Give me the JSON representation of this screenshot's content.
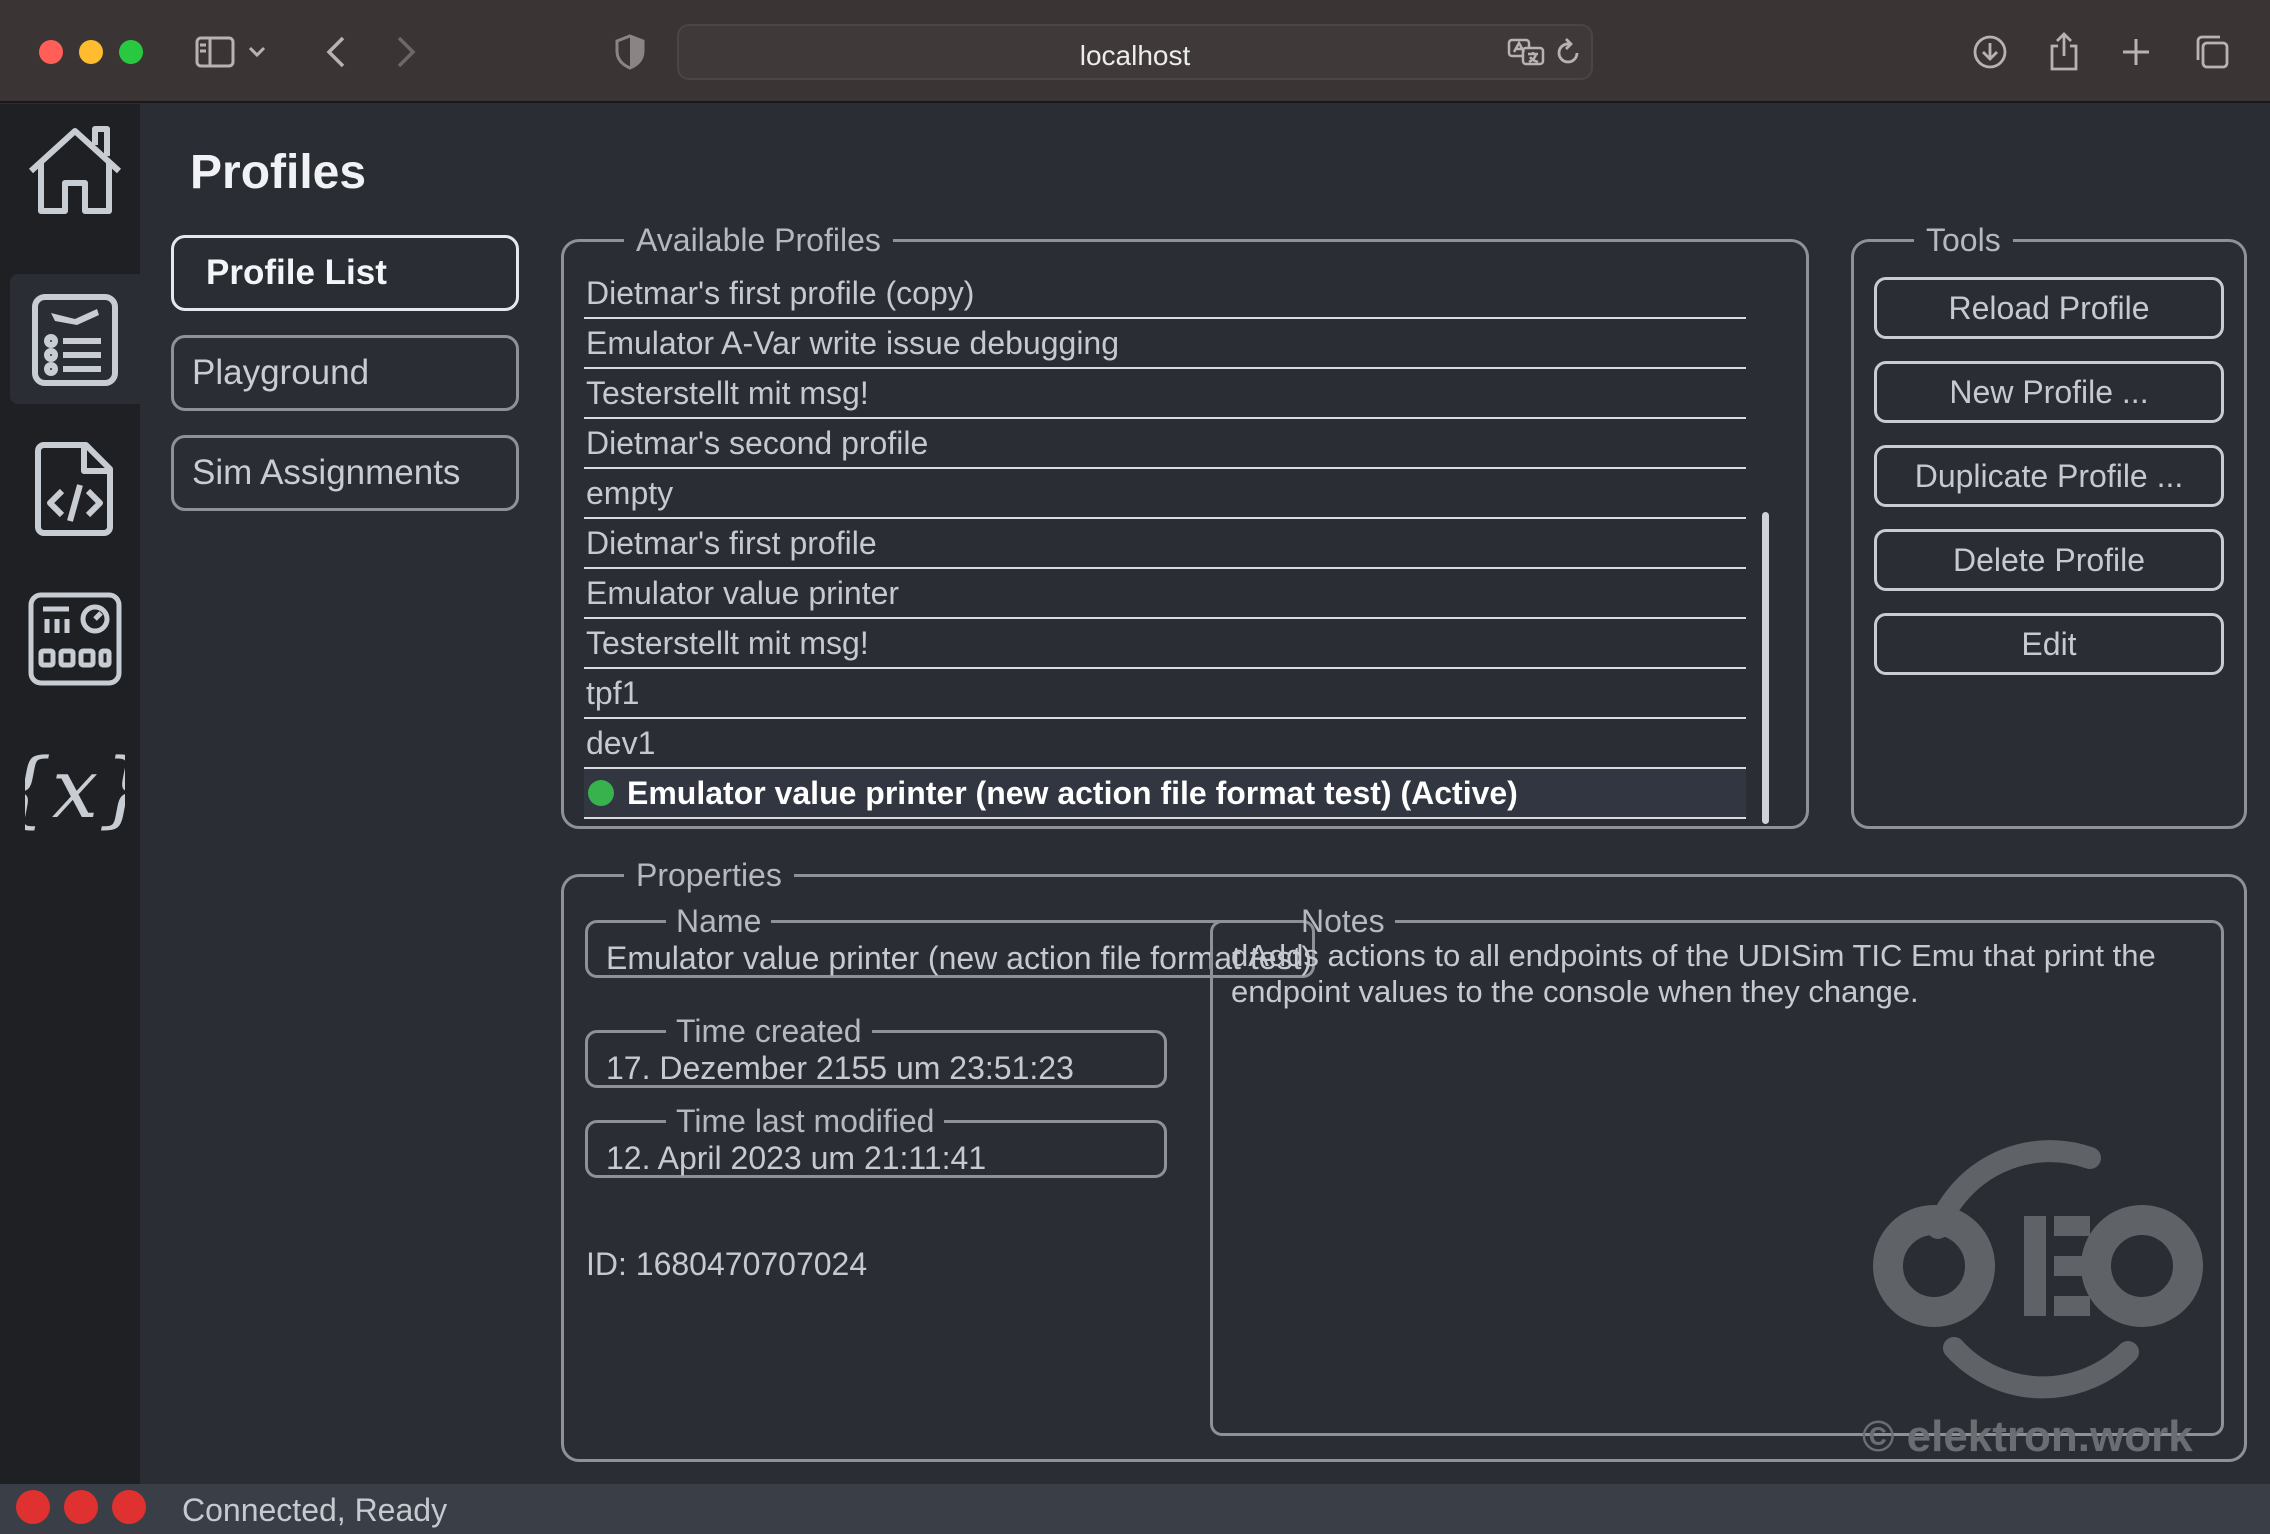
{
  "browser": {
    "url": "localhost",
    "traffic_colors": [
      "#ff5f57",
      "#febc2e",
      "#28c840"
    ]
  },
  "sidebar": {
    "items": [
      {
        "icon": "home-icon",
        "active": false
      },
      {
        "icon": "profile-list-icon",
        "active": true
      },
      {
        "icon": "code-file-icon",
        "active": false
      },
      {
        "icon": "control-panel-icon",
        "active": false
      },
      {
        "icon": "variables-icon",
        "active": false
      }
    ]
  },
  "page": {
    "title": "Profiles"
  },
  "nav": {
    "profile_list": "Profile List",
    "playground": "Playground",
    "sim_assignments": "Sim Assignments"
  },
  "profiles": {
    "legend": "Available Profiles",
    "items": [
      "Dietmar's first profile (copy)",
      "Emulator A-Var write issue debugging",
      "Testerstellt mit msg!",
      "Dietmar's second profile",
      "empty",
      "Dietmar's first profile",
      "Emulator value printer",
      "Testerstellt mit msg!",
      "tpf1",
      "dev1",
      "Emulator value printer (new action file format test) (Active)"
    ],
    "active_index": 10,
    "active_color": "#37b24d"
  },
  "tools": {
    "legend": "Tools",
    "reload": "Reload Profile",
    "new": "New Profile ...",
    "duplicate": "Duplicate Profile ...",
    "delete": "Delete Profile",
    "edit": "Edit"
  },
  "properties": {
    "legend": "Properties",
    "name_label": "Name",
    "name_value": "Emulator value printer (new action file format test)",
    "created_label": "Time created",
    "created_value": "17. Dezember 2155 um 23:51:23",
    "modified_label": "Time last modified",
    "modified_value": "12. April 2023 um 21:11:41",
    "id_text": "ID: 1680470707024",
    "notes_label": "Notes",
    "notes_value": "dAdds actions to all endpoints of the UDISim TIC Emu that print the endpoint values to the console when they change."
  },
  "watermark": {
    "copyright": "© elektron.work"
  },
  "status": {
    "text": "Connected, Ready",
    "dot_color": "#e03131"
  }
}
